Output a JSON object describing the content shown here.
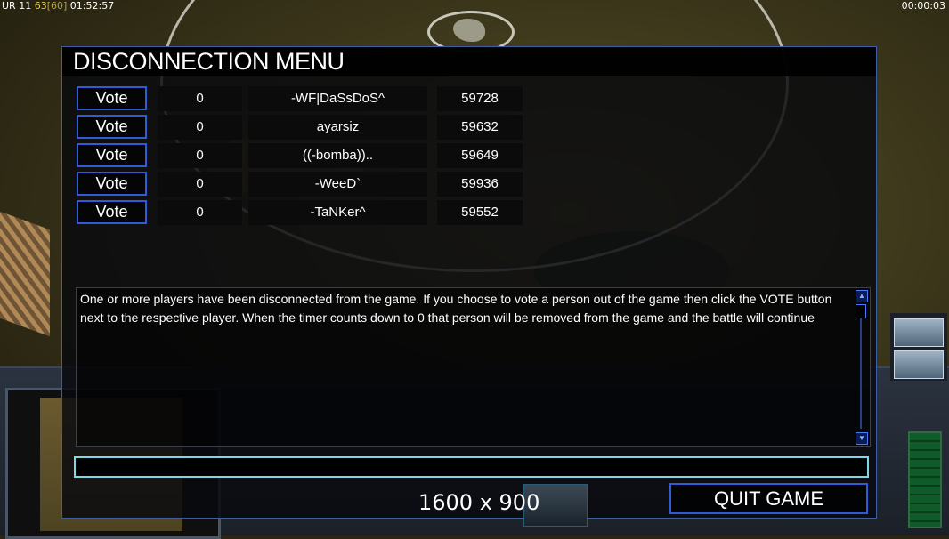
{
  "hud": {
    "top_left_prefix": "UR 11",
    "top_left_highlight": "63",
    "top_left_bracket": "[60]",
    "top_left_time": "01:52:57",
    "top_right_time": "00:00:03"
  },
  "menu": {
    "title": "DISCONNECTION MENU",
    "vote_label": "Vote",
    "players": [
      {
        "votes": "0",
        "name": "-WF|DaSsDoS^",
        "ping": "59728"
      },
      {
        "votes": "0",
        "name": "ayarsiz",
        "ping": "59632"
      },
      {
        "votes": "0",
        "name": "((-bomba))..",
        "ping": "59649"
      },
      {
        "votes": "0",
        "name": "-WeeD`",
        "ping": "59936"
      },
      {
        "votes": "0",
        "name": "-TaNKer^",
        "ping": "59552"
      }
    ],
    "message": "One or more players have been disconnected from the game. If you choose to vote a person out of the game then click the VOTE button next to the respective player. When the timer counts down to 0 that person will be removed from the game and the battle will continue",
    "chat_value": "",
    "quit_label": "QUIT GAME"
  },
  "overlay": {
    "resolution": "1600 x 900"
  },
  "colors": {
    "accent_blue": "#2f5bd8",
    "input_cyan": "#7fd6e6",
    "hud_yellow": "#e8d13a"
  },
  "icons": {
    "scroll_up": "triangle-up",
    "scroll_down": "triangle-down"
  }
}
